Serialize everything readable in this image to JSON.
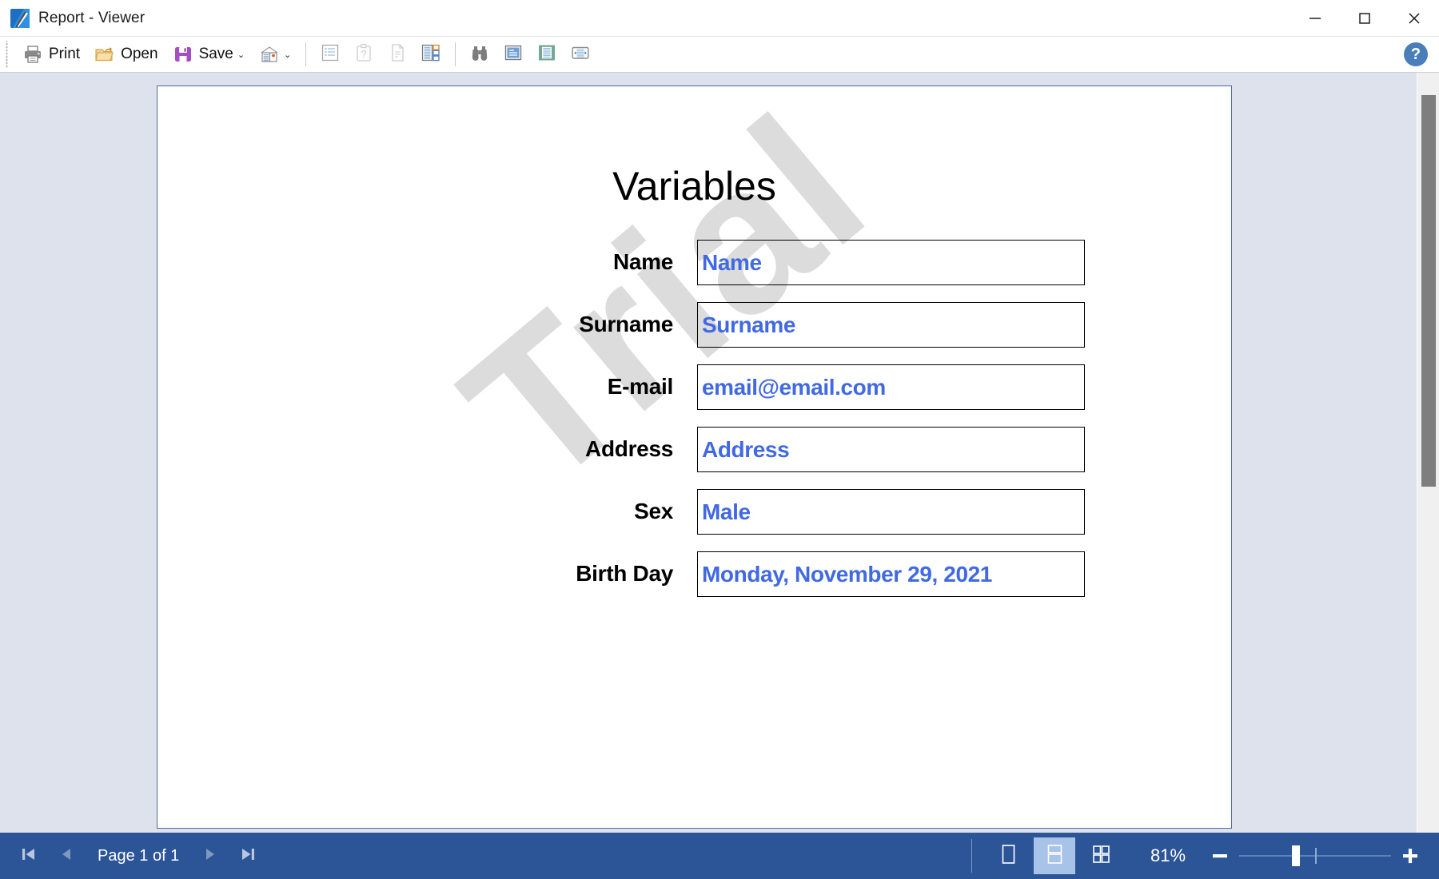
{
  "window": {
    "title": "Report - Viewer",
    "app_icon": "report-viewer-icon",
    "minimize_label": "Minimize",
    "maximize_label": "Maximize",
    "close_label": "Close"
  },
  "toolbar": {
    "print_label": "Print",
    "open_label": "Open",
    "save_label": "Save",
    "save_caret": "⌄",
    "buttons": [
      {
        "name": "page-setup-icon",
        "title": "Page Setup"
      },
      {
        "name": "bookmarks-icon",
        "title": "Bookmarks"
      },
      {
        "name": "parameters-icon",
        "title": "Parameters"
      },
      {
        "name": "document-info-icon",
        "title": "Document Info"
      },
      {
        "name": "thumbnails-icon",
        "title": "Thumbnails"
      },
      {
        "name": "find-icon",
        "title": "Find"
      },
      {
        "name": "page-view-icon",
        "title": "Page View"
      },
      {
        "name": "page-active-icon",
        "title": "Active Page"
      },
      {
        "name": "page-width-icon",
        "title": "Page Width"
      }
    ],
    "help_label": "?"
  },
  "document": {
    "title": "Variables",
    "watermark": "Trial",
    "fields": [
      {
        "label": "Name",
        "value": "Name"
      },
      {
        "label": "Surname",
        "value": "Surname"
      },
      {
        "label": "E-mail",
        "value": "email@email.com"
      },
      {
        "label": "Address",
        "value": "Address"
      },
      {
        "label": "Sex",
        "value": "Male"
      },
      {
        "label": "Birth Day",
        "value": "Monday, November 29, 2021"
      }
    ]
  },
  "statusbar": {
    "first_page_label": "First Page",
    "prev_page_label": "Previous Page",
    "page_indicator": "Page 1 of 1",
    "next_page_label": "Next Page",
    "last_page_label": "Last Page",
    "view_single_label": "Single Page",
    "view_continuous_label": "Continuous",
    "view_multi_label": "Multiple Pages",
    "zoom_level": "81%",
    "zoom_out_label": "−",
    "zoom_in_label": "+"
  },
  "colors": {
    "accent": "#2c5597",
    "field_text": "#4169e1",
    "page_border": "#4a6aa5",
    "viewer_bg": "#dde2ec",
    "watermark": "#dcdcdc",
    "help_blue": "#4a7ebb",
    "scroll_thumb": "#7e7e7e"
  }
}
